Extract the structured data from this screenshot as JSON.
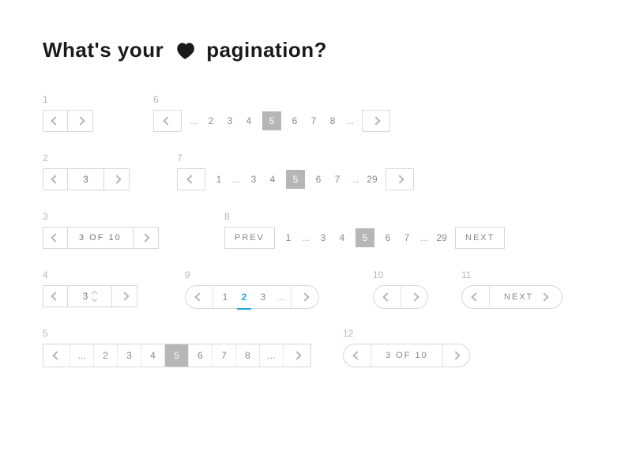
{
  "title": {
    "a": "What's your",
    "b": "pagination?"
  },
  "ex1": {
    "label": "1"
  },
  "ex2": {
    "label": "2",
    "current": "3"
  },
  "ex3": {
    "label": "3",
    "text": "3 OF 10"
  },
  "ex4": {
    "label": "4",
    "current": "3"
  },
  "ex5": {
    "label": "5",
    "pages": [
      "...",
      "2",
      "3",
      "4",
      "5",
      "6",
      "7",
      "8",
      "..."
    ],
    "active": "5"
  },
  "ex6": {
    "label": "6",
    "pages": [
      "...",
      "2",
      "3",
      "4",
      "5",
      "6",
      "7",
      "8",
      "..."
    ],
    "active": "5"
  },
  "ex7": {
    "label": "7",
    "pages": [
      "1",
      "...",
      "3",
      "4",
      "5",
      "6",
      "7",
      "...",
      "29"
    ],
    "active": "5"
  },
  "ex8": {
    "label": "8",
    "prev": "PREV",
    "next": "NEXT",
    "pages": [
      "1",
      "...",
      "3",
      "4",
      "5",
      "6",
      "7",
      "...",
      "29"
    ],
    "active": "5"
  },
  "ex9": {
    "label": "9",
    "pages": [
      "1",
      "2",
      "3",
      "..."
    ],
    "active": "2"
  },
  "ex10": {
    "label": "10"
  },
  "ex11": {
    "label": "11",
    "text": "NEXT"
  },
  "ex12": {
    "label": "12",
    "text": "3 OF 10"
  }
}
